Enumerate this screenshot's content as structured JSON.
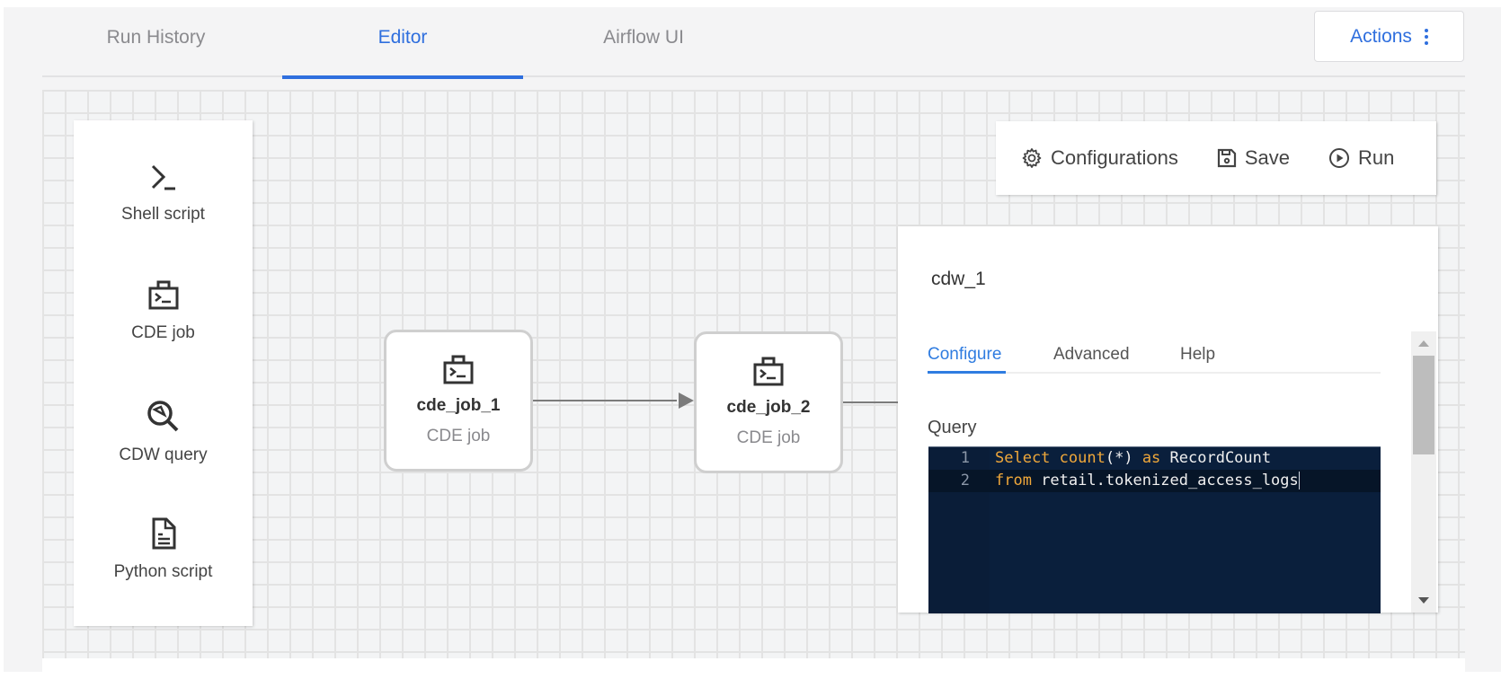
{
  "tabs": [
    {
      "label": "Run History",
      "active": false
    },
    {
      "label": "Editor",
      "active": true
    },
    {
      "label": "Airflow UI",
      "active": false
    }
  ],
  "actions": {
    "label": "Actions",
    "icon": "kebab-icon"
  },
  "palette": {
    "items": [
      {
        "label": "Shell script",
        "icon": "terminal-prompt-icon"
      },
      {
        "label": "CDE job",
        "icon": "cde-job-icon"
      },
      {
        "label": "CDW query",
        "icon": "cdw-query-icon"
      },
      {
        "label": "Python script",
        "icon": "document-icon"
      }
    ]
  },
  "nodes": [
    {
      "name": "cde_job_1",
      "type": "CDE job",
      "icon": "cde-job-icon"
    },
    {
      "name": "cde_job_2",
      "type": "CDE job",
      "icon": "cde-job-icon"
    }
  ],
  "toolbar": {
    "configurations_label": "Configurations",
    "save_label": "Save",
    "run_label": "Run"
  },
  "panel": {
    "title": "cdw_1",
    "tabs": [
      {
        "label": "Configure",
        "active": true
      },
      {
        "label": "Advanced",
        "active": false
      },
      {
        "label": "Help",
        "active": false
      }
    ],
    "query_label": "Query",
    "query_lines": [
      {
        "number": "1",
        "tokens": [
          {
            "t": "Select",
            "kw": true
          },
          {
            "t": " "
          },
          {
            "t": "count",
            "kw": true
          },
          {
            "t": "(*) "
          },
          {
            "t": "as",
            "kw": true
          },
          {
            "t": " RecordCount"
          }
        ]
      },
      {
        "number": "2",
        "tokens": [
          {
            "t": "from",
            "kw": true
          },
          {
            "t": " retail.tokenized_access_logs"
          }
        ]
      }
    ]
  },
  "colors": {
    "accent": "#2f6fde",
    "editor_bg": "#0a1f3c",
    "keyword": "#f0a83a"
  }
}
